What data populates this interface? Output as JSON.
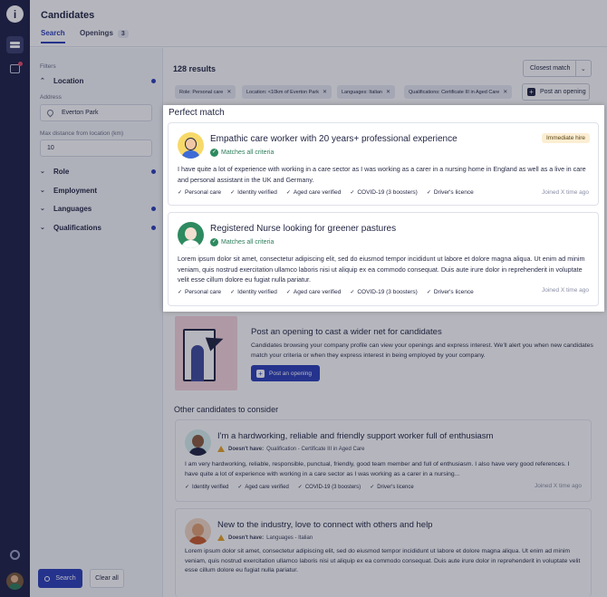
{
  "rail": {
    "icons": [
      "info-icon",
      "candidates-icon",
      "messages-icon",
      "settings-icon",
      "user-avatar"
    ]
  },
  "header": {
    "title": "Candidates",
    "tabs": [
      {
        "label": "Search"
      },
      {
        "label": "Openings",
        "count": "3"
      }
    ]
  },
  "filters": {
    "heading": "Filters",
    "location": {
      "label": "Location",
      "address_label": "Address",
      "address_value": "Everton Park",
      "distance_label": "Max distance from location (km)",
      "distance_value": "10"
    },
    "sections": [
      "Role",
      "Employment",
      "Languages",
      "Qualifications"
    ],
    "search_button": "Search",
    "clear_button": "Clear all"
  },
  "results": {
    "count_text": "128 results",
    "sort_label": "Closest match",
    "chips": [
      "Role: Personal care",
      "Location: <10km of Everton Park",
      "Languages: Italian",
      "Qualifications: Certificate III in Aged Care"
    ],
    "post_opening_label": "Post an opening"
  },
  "perfect_match": {
    "heading": "Perfect match",
    "cards": [
      {
        "title": "Empathic care worker with 20 years+ professional experience",
        "match_text": "Matches all criteria",
        "badge": "Immediate hire",
        "description": "I have quite a lot of experience with working in a care sector as I was working as a carer in a nursing home in England as well as a live in care and personal assistant in the UK and Germany.",
        "tags": [
          "Personal care",
          "Identity verified",
          "Aged care verified",
          "COVID-19 (3 boosters)",
          "Driver's licence"
        ],
        "joined": "Joined X time ago"
      },
      {
        "title": "Registered Nurse looking for greener pastures",
        "match_text": "Matches all criteria",
        "description": "Lorem ipsum dolor sit amet, consectetur adipiscing elit, sed do eiusmod tempor incididunt ut labore et dolore magna aliqua. Ut enim ad minim veniam, quis nostrud exercitation ullamco laboris nisi ut aliquip ex ea commodo consequat. Duis aute irure dolor in reprehenderit in voluptate velit esse cillum dolore eu fugiat nulla pariatur.",
        "tags": [
          "Personal care",
          "Identity verified",
          "Aged care verified",
          "COVID-19 (3 boosters)",
          "Driver's licence"
        ],
        "joined": "Joined X time ago"
      }
    ]
  },
  "banner": {
    "title": "Post an opening to cast a wider net for candidates",
    "text": "Candidates browsing your company profile can view your openings and express interest. We'll alert you when new candidates match your criteria or when they express interest in being employed by your company.",
    "button": "Post an opening"
  },
  "other": {
    "heading": "Other candidates to consider",
    "cards": [
      {
        "title": "I'm a hardworking, reliable and friendly support worker full of enthusiasm",
        "doesnt_label": "Doesn't have:",
        "doesnt_value": "Qualification - Certificate III in Aged Care",
        "description": "I am very hardworking, reliable, responsible, punctual, friendly, good team member and full of enthusiasm. I also have very good references. I have quite a lot of experience with working in a care sector as I was working as a carer in a nursing...",
        "tags": [
          "Identity verified",
          "Aged care verified",
          "COVID-19 (3 boosters)",
          "Driver's licence"
        ],
        "joined": "Joined X time ago"
      },
      {
        "title": "New to the industry, love to connect with others and help",
        "doesnt_label": "Doesn't have:",
        "doesnt_value": "Languages - Italian",
        "description": "Lorem ipsum dolor sit amet, consectetur adipiscing elit, sed do eiusmod tempor incididunt ut labore et dolore magna aliqua. Ut enim ad minim veniam, quis nostrud exercitation ullamco laboris nisi ut aliquip ex ea commodo consequat. Duis aute irure dolor in reprehenderit in voluptate velit esse cillum dolore eu fugiat nulla pariatur."
      }
    ]
  },
  "colors": {
    "rail": "#1c2045",
    "accent": "#2c3fb8",
    "match_green": "#2e8a5f",
    "badge_bg": "#fbeed3"
  }
}
